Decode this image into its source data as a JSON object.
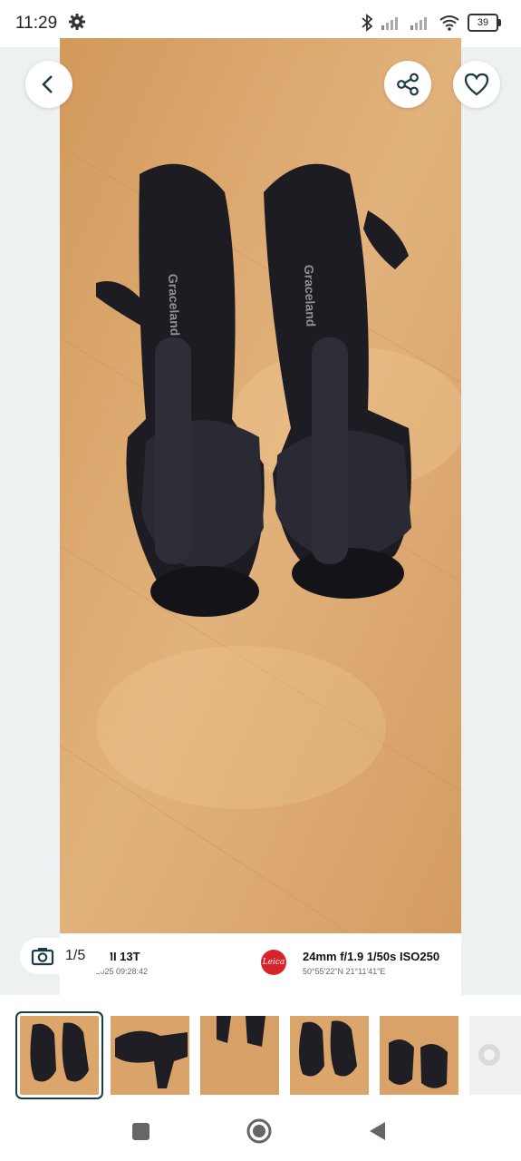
{
  "status_bar": {
    "time": "11:29",
    "battery": "39",
    "icons": [
      "gear-icon",
      "bluetooth-icon",
      "signal-icon",
      "signal-icon",
      "wifi-icon",
      "battery-icon"
    ]
  },
  "top_actions": {
    "back_icon": "chevron-left-icon",
    "share_icon": "share-icon",
    "favorite_icon": "heart-icon"
  },
  "photo": {
    "brand_text": "Graceland"
  },
  "counter": {
    "icon": "camera-icon",
    "text": "1/5"
  },
  "exif": {
    "model": "OMI 13T",
    "datetime": "..02.2025  09:28:42",
    "leica_logo": "Leica",
    "params": "24mm  f/1.9  1/50s  ISO250",
    "coordinates": "50°55'22\"N  21°11'41\"E"
  },
  "thumbnails": {
    "count_visible": 6,
    "selected_index": 0
  },
  "colors": {
    "accent": "#1d3b45",
    "background": "#eef1f2",
    "floor": "#d9a366",
    "leica_red": "#d8232a"
  }
}
